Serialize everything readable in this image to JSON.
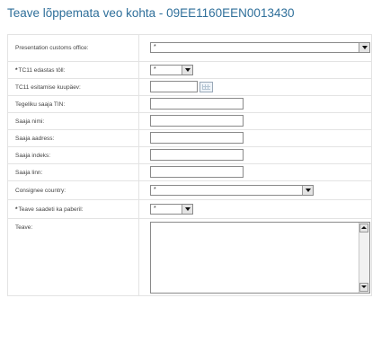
{
  "title": "Teave lõppemata veo kohta - 09EE1160EEN0013430",
  "form": {
    "presentation_office": {
      "label": "Presentation customs office:",
      "value": "*"
    },
    "tc11_edastas": {
      "required_mark": "*",
      "label": "TC11 edastas töll:",
      "value": "*"
    },
    "tc11_date": {
      "label": "TC11 esitamise kuupäev:",
      "value": ""
    },
    "tin": {
      "label": "Tegeliku saaja TIN:",
      "value": ""
    },
    "name": {
      "label": "Saaja nimi:",
      "value": ""
    },
    "address": {
      "label": "Saaja aadress:",
      "value": ""
    },
    "postal": {
      "label": "Saaja indeks:",
      "value": ""
    },
    "city": {
      "label": "Saaja linn:",
      "value": ""
    },
    "consignee_country": {
      "label": "Consignee country:",
      "value": "*"
    },
    "paper_sent": {
      "required_mark": "*",
      "label": "Teave saadeti ka paberil:",
      "value": "*"
    },
    "info": {
      "label": "Teave:",
      "value": ""
    }
  },
  "icons": {
    "dropdown": "chevron-down-icon",
    "calendar": "calendar-icon",
    "scroll_up": "scroll-up-icon",
    "scroll_down": "scroll-down-icon"
  },
  "colors": {
    "title": "#2f6f9a",
    "row_border": "#e3e3e3",
    "field_border": "#8a8a8a"
  }
}
